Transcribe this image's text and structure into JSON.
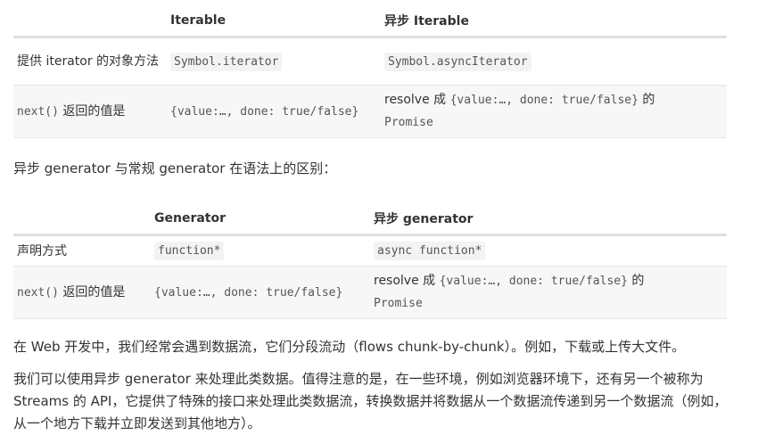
{
  "table1": {
    "headers": [
      "",
      "Iterable",
      "异步 Iterable"
    ],
    "row1": {
      "label": "提供 iterator 的对象方法",
      "iterable": "Symbol.iterator",
      "async_iterable": "Symbol.asyncIterator"
    },
    "row2": {
      "label_code": "next()",
      "label_text": " 返回的值是",
      "iterable_code": "{value:…, done: true/false}",
      "async_prefix": "resolve 成 ",
      "async_code": "{value:…, done: true/false}",
      "async_suffix": " 的",
      "async_promise": "Promise"
    }
  },
  "section_heading": "异步 generator 与常规 generator 在语法上的区别：",
  "table2": {
    "headers": [
      "",
      "Generator",
      "异步 generator"
    ],
    "row1": {
      "label": "声明方式",
      "generator": "function*",
      "async_generator": "async function*"
    },
    "row2": {
      "label_code": "next()",
      "label_text": " 返回的值是",
      "generator_code": "{value:…, done: true/false}",
      "async_prefix": "resolve 成 ",
      "async_code": "{value:…, done: true/false}",
      "async_suffix": " 的",
      "async_promise": "Promise"
    }
  },
  "paragraph1": "在 Web 开发中，我们经常会遇到数据流，它们分段流动（flows chunk-by-chunk）。例如，下载或上传大文件。",
  "paragraph2": "我们可以使用异步 generator 来处理此类数据。值得注意的是，在一些环境，例如浏览器环境下，还有另一个被称为 Streams 的 API，它提供了特殊的接口来处理此类数据流，转换数据并将数据从一个数据流传递到另一个数据流（例如，从一个地方下载并立即发送到其他地方）。"
}
